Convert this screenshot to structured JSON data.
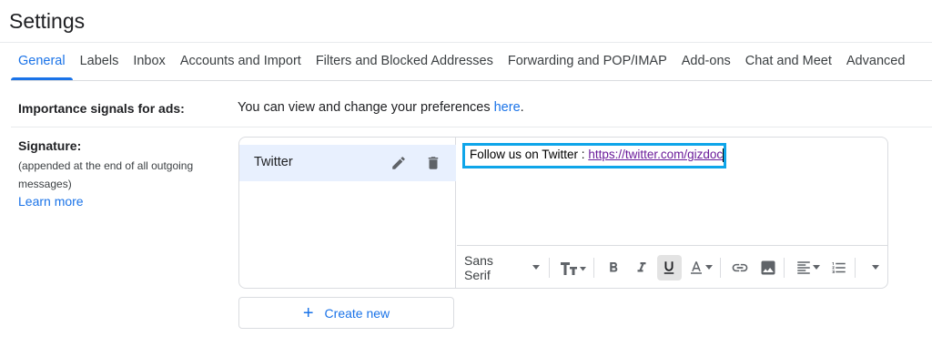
{
  "page": {
    "title": "Settings"
  },
  "tabs": [
    {
      "label": "General",
      "active": true
    },
    {
      "label": "Labels"
    },
    {
      "label": "Inbox"
    },
    {
      "label": "Accounts and Import"
    },
    {
      "label": "Filters and Blocked Addresses"
    },
    {
      "label": "Forwarding and POP/IMAP"
    },
    {
      "label": "Add-ons"
    },
    {
      "label": "Chat and Meet"
    },
    {
      "label": "Advanced"
    }
  ],
  "importance": {
    "label": "Importance signals for ads:",
    "text": "You can view and change your preferences ",
    "link": "here",
    "suffix": "."
  },
  "signature": {
    "label": "Signature:",
    "sub": "(appended at the end of all outgoing messages)",
    "learn_more": "Learn more",
    "items": [
      {
        "name": "Twitter"
      }
    ],
    "editor": {
      "text": "Follow us on Twitter : ",
      "link": "https://twitter.com/gizdoc"
    },
    "toolbar": {
      "font": "Sans Serif"
    },
    "create_new": "Create new"
  },
  "icons": {
    "edit": "pencil-icon",
    "trash": "trash-icon",
    "plus": "plus-icon"
  },
  "colors": {
    "accent": "#1a73e8",
    "highlight": "#0ea5e9",
    "selected_bg": "#e8f0fe"
  }
}
